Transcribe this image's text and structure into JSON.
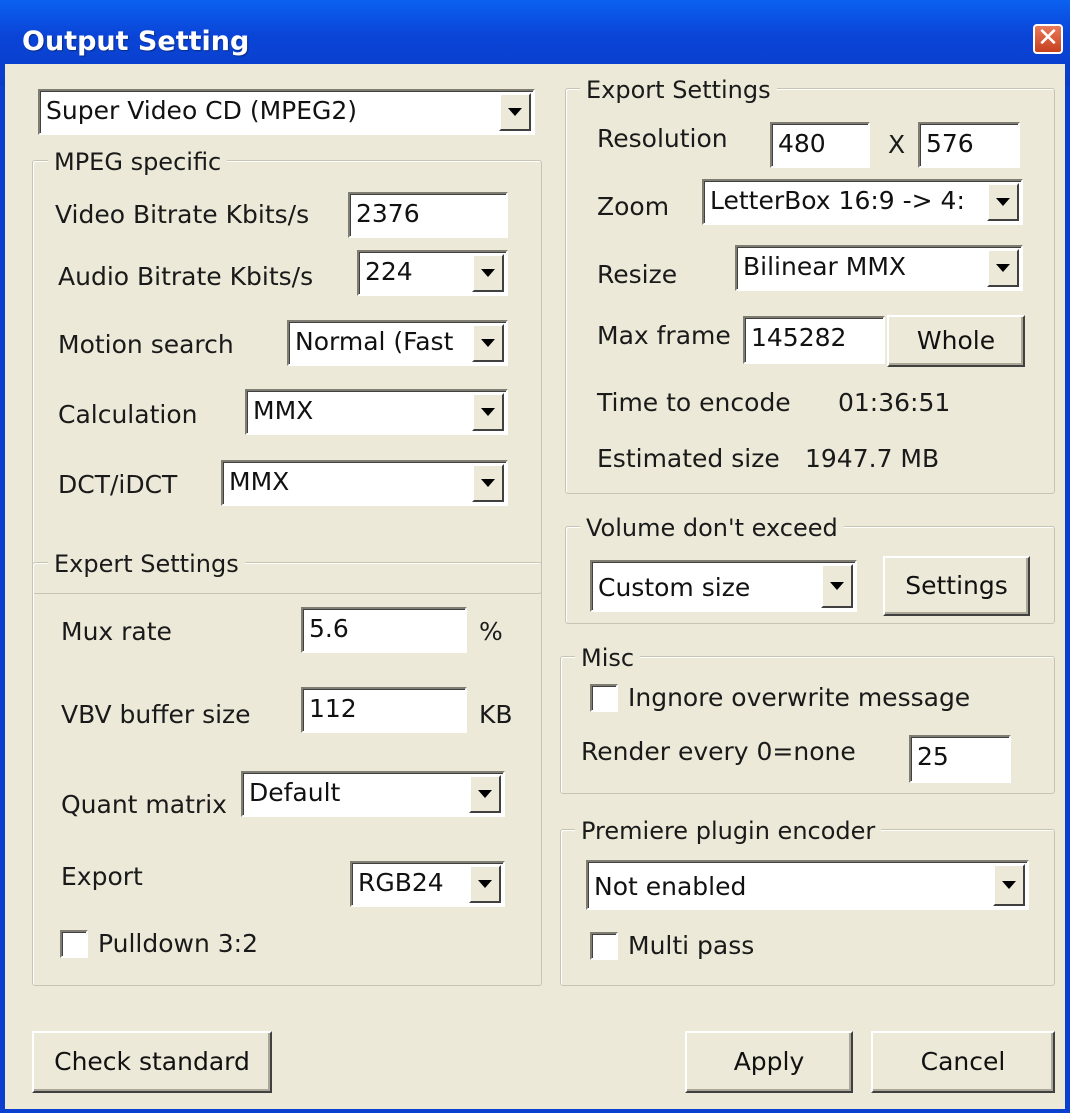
{
  "window": {
    "title": "Output Setting",
    "close_glyph": "✕"
  },
  "format_select": {
    "value": "Super Video CD (MPEG2)"
  },
  "mpeg": {
    "group_label": "MPEG specific",
    "video_bitrate_label": "Video Bitrate Kbits/s",
    "video_bitrate_value": "2376",
    "audio_bitrate_label": "Audio Bitrate Kbits/s",
    "audio_bitrate_value": "224",
    "motion_label": "Motion search",
    "motion_value": "Normal (Fast",
    "calc_label": "Calculation",
    "calc_value": "MMX",
    "dct_label": "DCT/iDCT",
    "dct_value": "MMX"
  },
  "expert": {
    "group_label": "Expert Settings",
    "mux_label": "Mux rate",
    "mux_value": "5.6",
    "mux_unit": "%",
    "vbv_label": "VBV buffer size",
    "vbv_value": "112",
    "vbv_unit": "KB",
    "quant_label": "Quant matrix",
    "quant_value": "Default",
    "export_label": "Export",
    "export_value": "RGB24",
    "pulldown_label": "Pulldown 3:2"
  },
  "export": {
    "group_label": "Export Settings",
    "resolution_label": "Resolution",
    "res_width": "480",
    "res_x": "X",
    "res_height": "576",
    "zoom_label": "Zoom",
    "zoom_value": "LetterBox 16:9 -> 4:",
    "resize_label": "Resize",
    "resize_value": "Bilinear MMX",
    "maxframe_label": "Max frame",
    "maxframe_value": "145282",
    "whole_button": "Whole",
    "time_label": "Time to encode",
    "time_value": "01:36:51",
    "size_label": "Estimated size",
    "size_value": "1947.7 MB"
  },
  "volume": {
    "group_label": "Volume don't exceed",
    "select_value": "Custom size",
    "settings_button": "Settings"
  },
  "misc": {
    "group_label": "Misc",
    "ignore_label": "Ingnore overwrite message",
    "render_label": "Render every 0=none",
    "render_value": "25"
  },
  "premiere": {
    "group_label": "Premiere plugin encoder",
    "select_value": "Not enabled",
    "multipass_label": "Multi pass"
  },
  "footer": {
    "check_button": "Check standard",
    "apply_button": "Apply",
    "cancel_button": "Cancel"
  }
}
